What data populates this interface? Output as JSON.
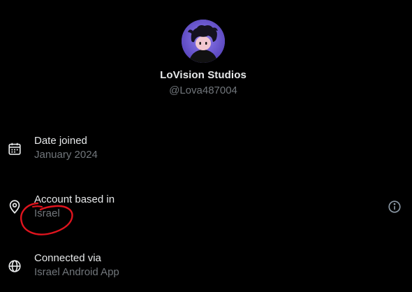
{
  "profile": {
    "display_name": "LoVision Studios",
    "handle": "@Lova487004"
  },
  "rows": [
    {
      "label": "Date joined",
      "value": "January 2024",
      "icon": "calendar-icon"
    },
    {
      "label": "Account based in",
      "value": "Israel",
      "icon": "location-pin-icon",
      "action_icon": "info-icon"
    },
    {
      "label": "Connected via",
      "value": "Israel Android App",
      "icon": "globe-icon"
    }
  ],
  "colors": {
    "background": "#000000",
    "primary_text": "#e7e9ea",
    "secondary_text": "#71767b",
    "annotation": "#e0141e",
    "avatar_bg": "#6d5bd0"
  }
}
